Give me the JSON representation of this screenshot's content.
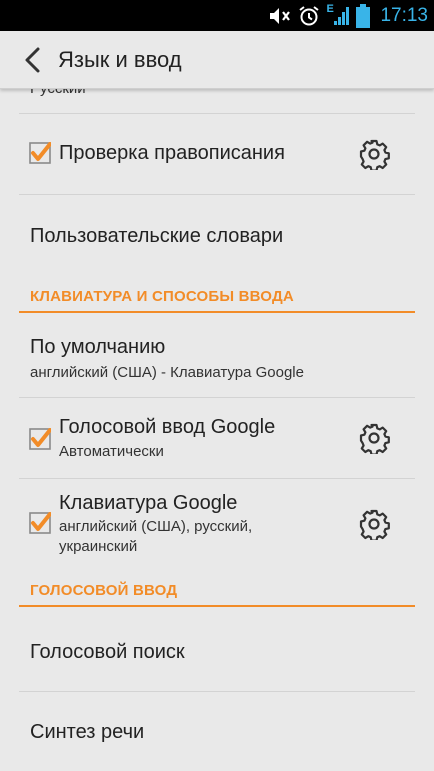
{
  "status_bar": {
    "time": "17:13",
    "icons": [
      "mute-icon",
      "alarm-icon",
      "signal-e-icon",
      "battery-icon"
    ],
    "signal_label": "E"
  },
  "action_bar": {
    "title": "Язык и ввод"
  },
  "top_summary": "Русский",
  "items": {
    "spell_check": {
      "title": "Проверка правописания",
      "checked": true
    },
    "user_dict": {
      "title": "Пользовательские словари"
    },
    "default": {
      "title": "По умолчанию",
      "summary": "английский (США) - Клавиатура Google"
    },
    "google_voice": {
      "title": "Голосовой ввод Google",
      "summary": "Автоматически",
      "checked": true
    },
    "google_keyboard": {
      "title": "Клавиатура Google",
      "summary": "английский (США), русский, украинский",
      "checked": true
    },
    "voice_search": {
      "title": "Голосовой поиск"
    },
    "tts": {
      "title": "Синтез речи"
    }
  },
  "sections": {
    "keyboard": "КЛАВИАТУРА И СПОСОБЫ ВВОДА",
    "voice": "ГОЛОСОВОЙ ВВОД"
  },
  "colors": {
    "accent": "#f28c28",
    "clock": "#39b4e8",
    "background": "#e9e9e9"
  }
}
